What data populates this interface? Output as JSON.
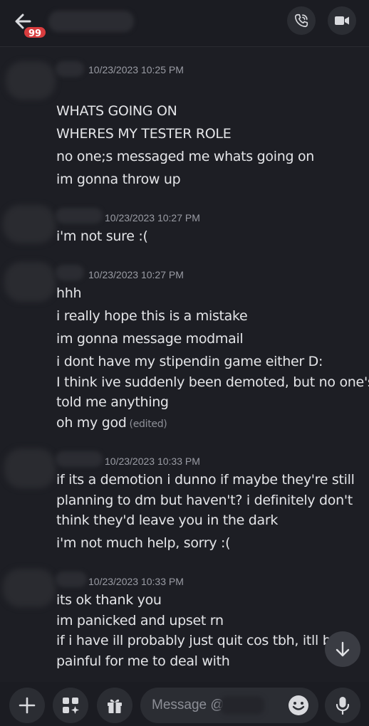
{
  "header": {
    "unread_badge": "99",
    "icons": {
      "back": "arrow-left-icon",
      "call": "phone-call-icon",
      "video": "video-camera-icon"
    }
  },
  "messages": [
    {
      "timestamp": "10/23/2023 10:25 PM",
      "lines": [
        "WHATS GOING ON",
        "WHERES MY TESTER ROLE",
        "no one;s messaged me whats going on",
        "im gonna throw up"
      ]
    },
    {
      "timestamp": "10/23/2023 10:27 PM",
      "lines": [
        "i'm not sure :("
      ]
    },
    {
      "timestamp": "10/23/2023 10:27 PM",
      "lines": [
        "hhh",
        "i really hope this is a mistake",
        "im gonna message modmail",
        "i dont have my stipendin game either D:",
        "I think ive suddenly been demoted, but no one's",
        "told me anything",
        "oh my god"
      ],
      "edited_label": "(edited)"
    },
    {
      "timestamp": "10/23/2023 10:33 PM",
      "lines": [
        "if its a demotion i dunno if maybe they're still",
        "planning to dm but haven't? i definitely don't",
        "think they'd leave you in the dark",
        "i'm not much help, sorry :("
      ]
    },
    {
      "timestamp": "10/23/2023 10:33 PM",
      "lines": [
        "its ok thank you",
        "im panicked and upset rn",
        "if i have ill probably just quit cos tbh, itll be h",
        "painful for me to deal with"
      ]
    }
  ],
  "composer": {
    "placeholder": "Message @",
    "icons": {
      "add": "plus-icon",
      "apps": "apps-sparkle-icon",
      "gift": "gift-icon",
      "emoji": "emoji-icon",
      "voice": "microphone-icon"
    }
  },
  "scroll_button": {
    "icon": "arrow-down-icon"
  },
  "colors": {
    "background": "#1d1e24",
    "bar": "#1b1c22",
    "button": "#2b2d33",
    "badge": "#d83c3e",
    "text": "#e4e5e8",
    "timestamp": "#9a9ca4"
  }
}
